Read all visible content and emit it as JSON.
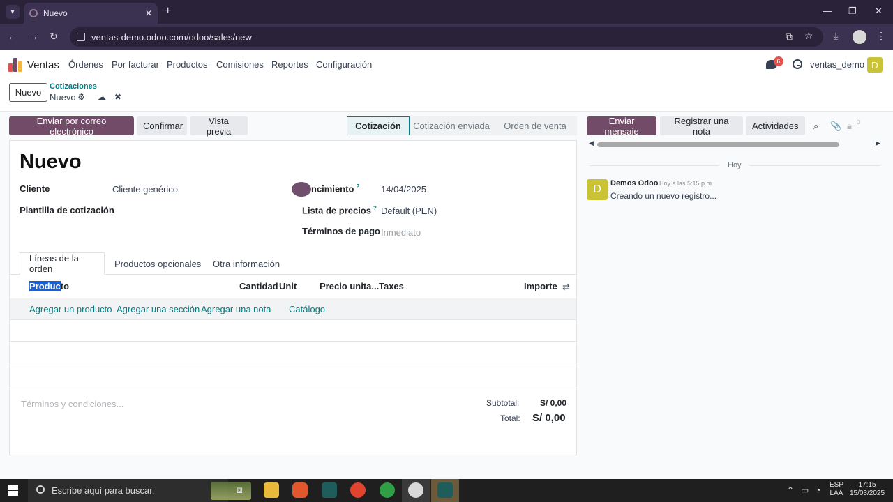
{
  "browser": {
    "tab_title": "Nuevo",
    "url": "ventas-demo.odoo.com/odoo/sales/new"
  },
  "nav": {
    "app_name": "Ventas",
    "menu": [
      "Órdenes",
      "Por facturar",
      "Productos",
      "Comisiones",
      "Reportes",
      "Configuración"
    ],
    "messages_badge": "6",
    "user": "ventas_demo",
    "avatar_letter": "D"
  },
  "control_panel": {
    "new_button": "Nuevo",
    "breadcrumb_parent": "Cotizaciones",
    "breadcrumb_current": "Nuevo"
  },
  "actions": {
    "send_email": "Enviar por correo electrónico",
    "confirm": "Confirmar",
    "preview": "Vista previa"
  },
  "stages": [
    "Cotización",
    "Cotización enviada",
    "Orden de venta"
  ],
  "form": {
    "title": "Nuevo",
    "customer_label": "Cliente",
    "customer_value": "Cliente genérico",
    "template_label": "Plantilla de cotización",
    "expiration_label": "ncimiento",
    "expiration_value": "14/04/2025",
    "pricelist_label": "Lista de precios",
    "pricelist_value": "Default (PEN)",
    "payment_terms_label": "Términos de pago",
    "payment_terms_placeholder": "Inmediato",
    "help_mark": "?"
  },
  "notebook": {
    "tabs": [
      "Líneas de la orden",
      "Productos opcionales",
      "Otra información"
    ]
  },
  "lines": {
    "col_product_selected": "Produc",
    "col_product_rest": "to",
    "col_quantity": "Cantidad",
    "col_unit": "Unit",
    "col_price": "Precio unita...",
    "col_taxes": "Taxes",
    "col_amount": "Importe",
    "add_product": "Agregar un producto",
    "add_section": "Agregar una sección",
    "add_note": "Agregar una nota",
    "catalog": "Catálogo"
  },
  "totals": {
    "terms_placeholder": "Términos y condiciones...",
    "subtotal_label": "Subtotal:",
    "subtotal_value": "S/ 0,00",
    "total_label": "Total:",
    "total_value": "S/ 0,00"
  },
  "chatter": {
    "send_message": "Enviar mensaje",
    "log_note": "Registrar una nota",
    "activities": "Actividades",
    "followers_count": "0",
    "date_separator": "Hoy",
    "author": "Demos Odoo",
    "time": "Hoy a las 5:15 p.m.",
    "body": "Creando un nuevo registro...",
    "avatar_letter": "D"
  },
  "taskbar": {
    "search_placeholder": "Escribe aquí para buscar.",
    "lang_top": "ESP",
    "lang_bottom": "LAA",
    "time": "17:15",
    "date": "15/03/2025"
  },
  "colors": {
    "primary": "#714b67",
    "accent": "#017e84"
  }
}
